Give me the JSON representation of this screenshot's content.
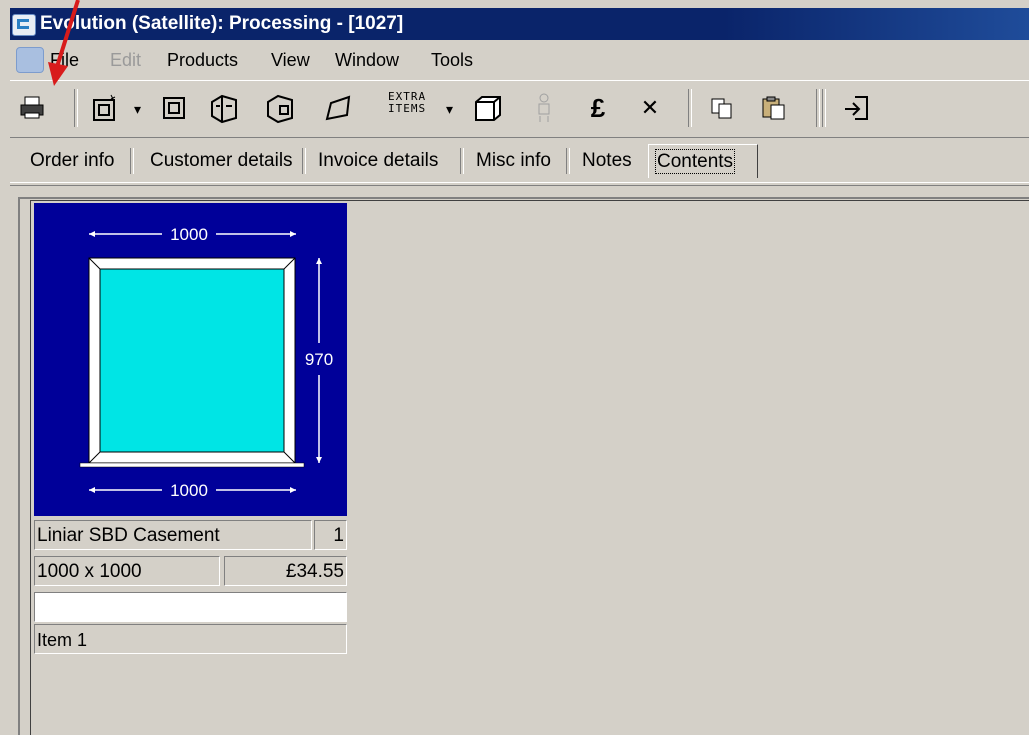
{
  "window": {
    "title": "Evolution (Satellite): Processing - [1027]"
  },
  "menu": {
    "items": [
      {
        "label": "File",
        "disabled": false
      },
      {
        "label": "Edit",
        "disabled": true
      },
      {
        "label": "Products",
        "disabled": false
      },
      {
        "label": "View",
        "disabled": false
      },
      {
        "label": "Window",
        "disabled": false
      },
      {
        "label": "Tools",
        "disabled": false
      }
    ]
  },
  "toolbar": {
    "icons": [
      "print-icon",
      "new-frame-icon",
      "square-frame-icon",
      "bay-icon",
      "bow-icon",
      "shaped-icon",
      "extra-items-icon",
      "box-icon",
      "figure-icon",
      "pound-icon",
      "delete-icon",
      "copy-icon",
      "paste-icon",
      "exit-icon"
    ],
    "pound_label": "£",
    "delete_label": "✕",
    "extra_items_line1": "EXTRA",
    "extra_items_line2": "ITEMS"
  },
  "tabs": {
    "items": [
      "Order info",
      "Customer details",
      "Invoice details",
      "Misc info",
      "Notes",
      "Contents"
    ],
    "active": "Contents"
  },
  "item": {
    "width_label_top": "1000",
    "width_label_bottom": "1000",
    "height_label": "970",
    "product": "Liniar SBD Casement",
    "quantity": "1",
    "size": "1000 x 1000",
    "price": "£34.55",
    "note_value": "",
    "name": "Item 1"
  },
  "colors": {
    "drawing_bg": "#000099",
    "glass": "#00e5e5",
    "frame": "#ffffff",
    "annotation_arrow": "#d81b1b"
  }
}
